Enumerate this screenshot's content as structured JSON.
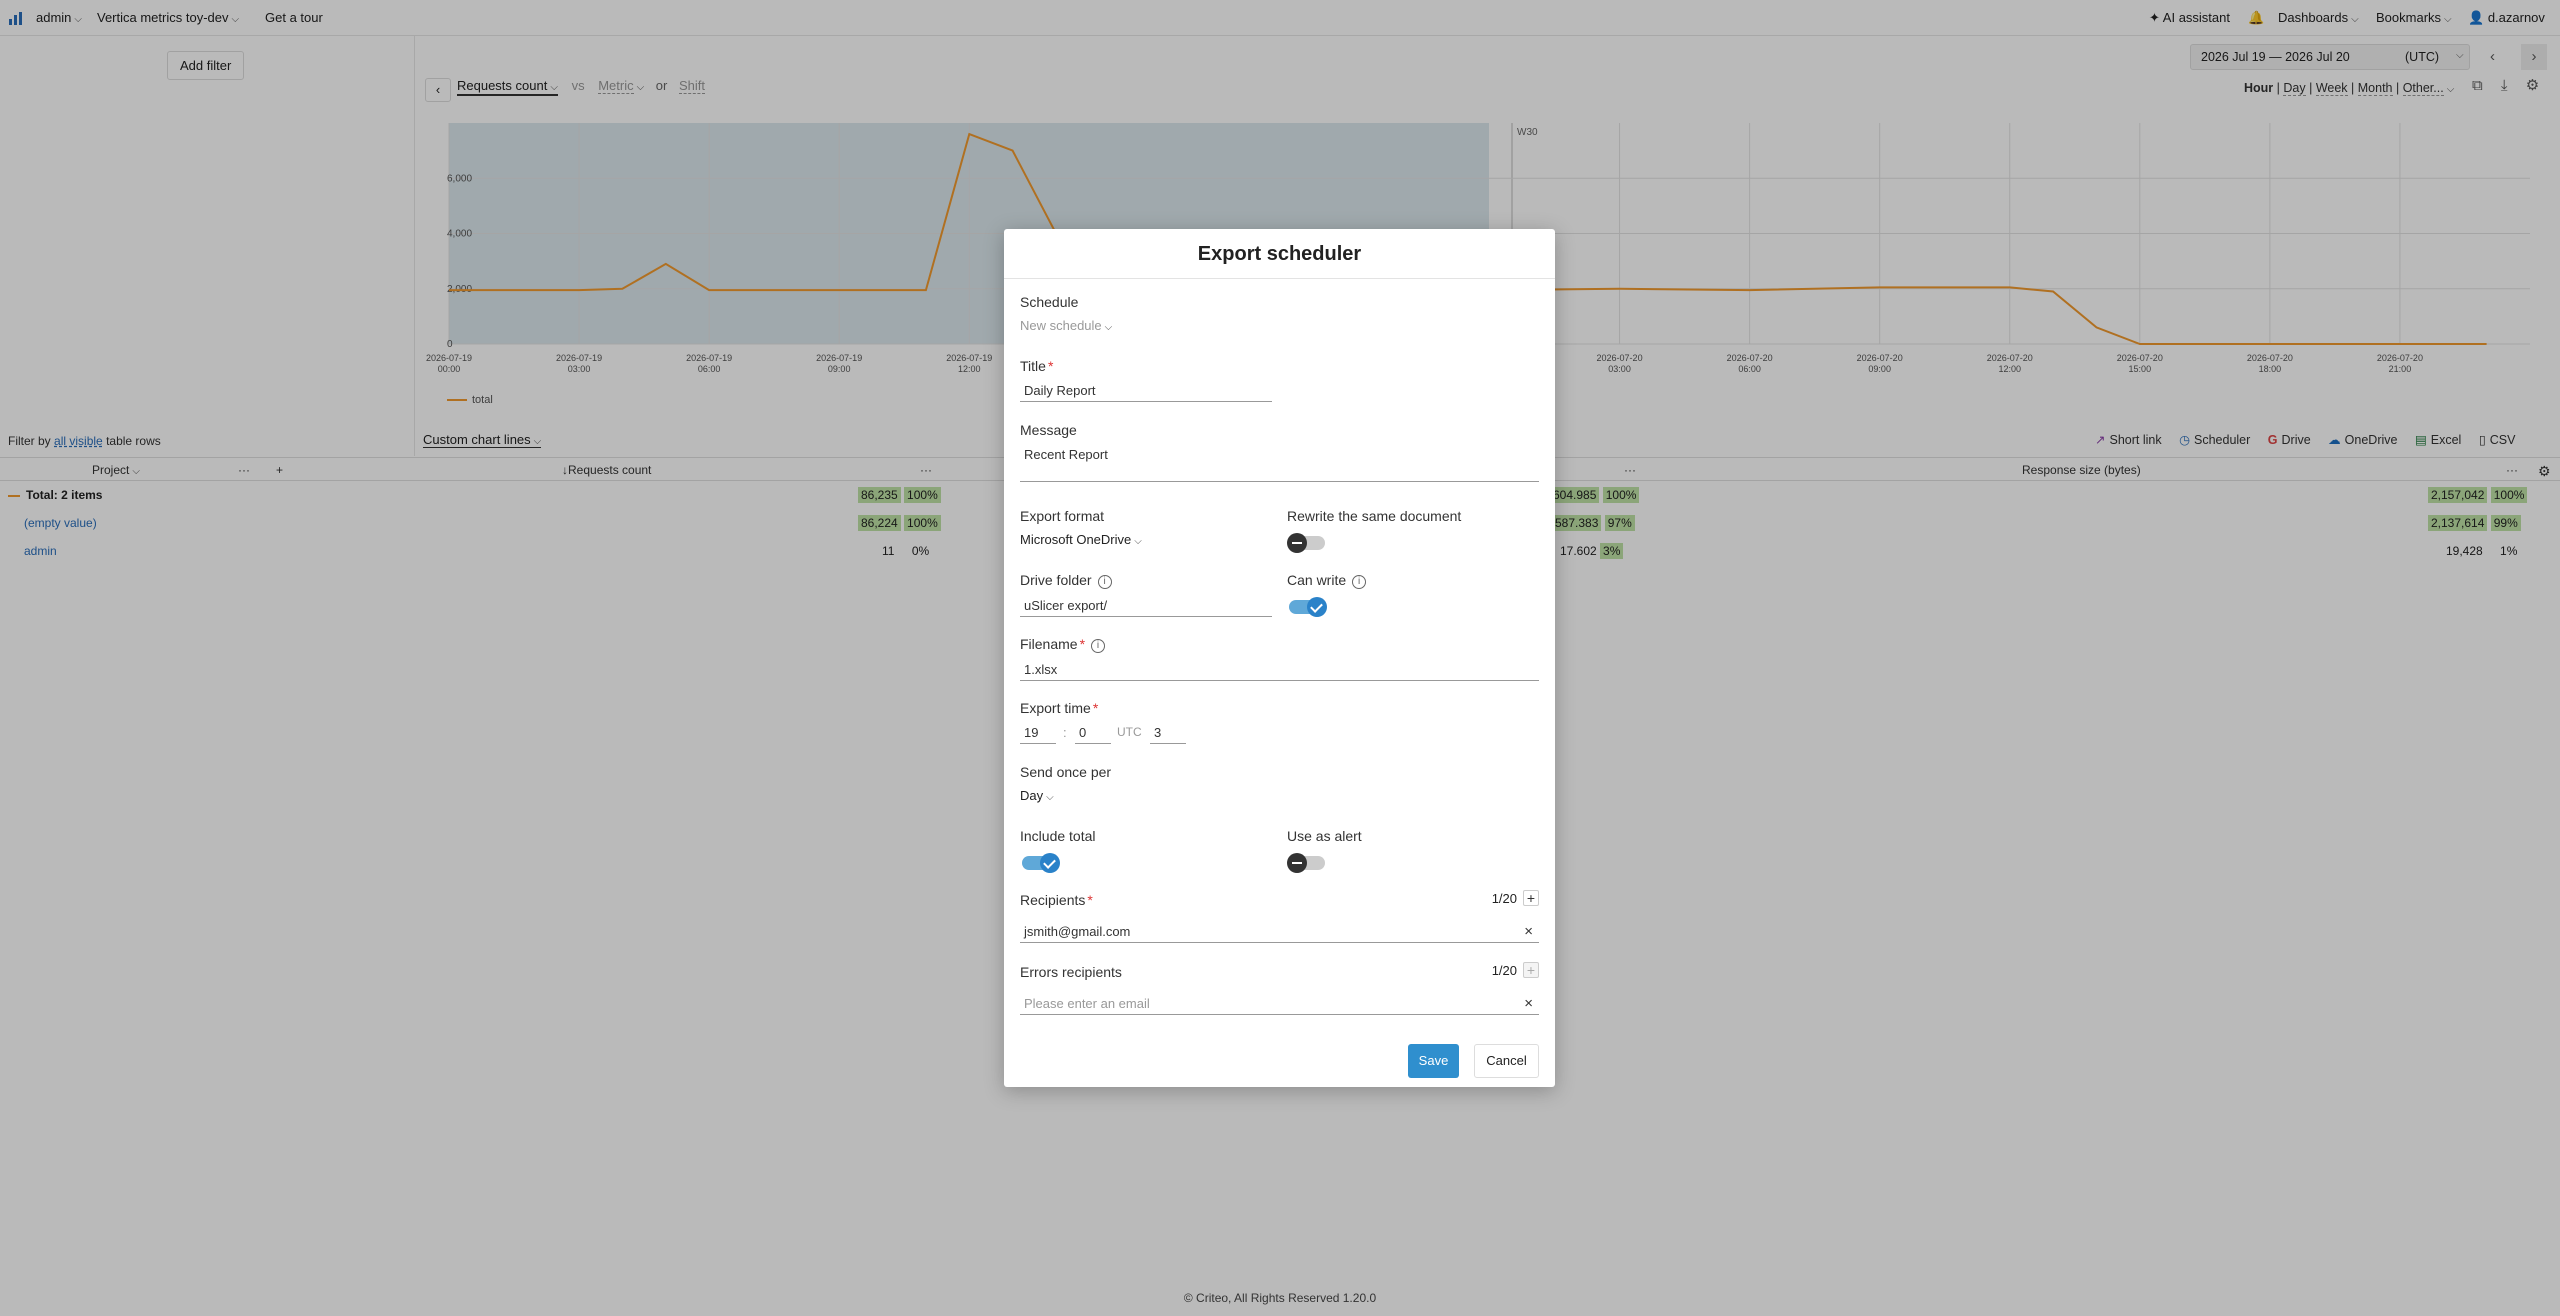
{
  "topbar": {
    "user_menu": "admin",
    "project": "Vertica metrics toy-dev",
    "tour": "Get a tour",
    "ai_assistant": "AI assistant",
    "dashboards": "Dashboards",
    "bookmarks": "Bookmarks",
    "account": "d.azarnov"
  },
  "left": {
    "add_filter": "Add filter",
    "filter_by_prefix": "Filter by",
    "filter_by_link": "all visible",
    "filter_by_suffix": "table rows"
  },
  "chart_controls": {
    "metric": "Requests count",
    "vs": "vs",
    "metric_placeholder": "Metric",
    "or": "or",
    "shift": "Shift",
    "date_range": "2026 Jul 19 — 2026 Jul 20",
    "timezone": "(UTC)",
    "granularity": [
      "Hour",
      "Day",
      "Week",
      "Month",
      "Other..."
    ],
    "granularity_selected": "Hour",
    "custom_chart_lines": "Custom chart lines"
  },
  "chart_data": {
    "type": "line",
    "series": [
      {
        "name": "total",
        "color": "#f29a2e",
        "points": [
          [
            "2026-07-19 00:00",
            1950
          ],
          [
            "2026-07-19 03:00",
            1950
          ],
          [
            "2026-07-19 04:00",
            2000
          ],
          [
            "2026-07-19 05:00",
            2900
          ],
          [
            "2026-07-19 06:00",
            1950
          ],
          [
            "2026-07-19 09:00",
            1950
          ],
          [
            "2026-07-19 11:00",
            1950
          ],
          [
            "2026-07-19 12:00",
            7600
          ],
          [
            "2026-07-19 13:00",
            7000
          ],
          [
            "2026-07-19 14:00",
            4000
          ],
          [
            "2026-07-20 00:00",
            1950
          ],
          [
            "2026-07-20 03:00",
            2000
          ],
          [
            "2026-07-20 06:00",
            1950
          ],
          [
            "2026-07-20 09:00",
            2050
          ],
          [
            "2026-07-20 12:00",
            2050
          ],
          [
            "2026-07-20 13:00",
            1900
          ],
          [
            "2026-07-20 14:00",
            600
          ],
          [
            "2026-07-20 15:00",
            0
          ],
          [
            "2026-07-20 23:00",
            0
          ]
        ]
      }
    ],
    "x_tick_labels": [
      [
        "2026-07-19",
        "00:00"
      ],
      [
        "2026-07-19",
        "03:00"
      ],
      [
        "2026-07-19",
        "06:00"
      ],
      [
        "2026-07-19",
        "09:00"
      ],
      [
        "2026-07-19",
        "12:00"
      ],
      [
        "2026-07-20",
        "03:00"
      ],
      [
        "2026-07-20",
        "06:00"
      ],
      [
        "2026-07-20",
        "09:00"
      ],
      [
        "2026-07-20",
        "12:00"
      ],
      [
        "2026-07-20",
        "15:00"
      ],
      [
        "2026-07-20",
        "18:00"
      ],
      [
        "2026-07-20",
        "21:00"
      ]
    ],
    "y_ticks": [
      "0",
      "2,000",
      "4,000",
      "6,000"
    ],
    "ylim": [
      0,
      8000
    ],
    "week_label": "W30",
    "legend": "total"
  },
  "export_bar": {
    "short_link": "Short link",
    "scheduler": "Scheduler",
    "drive": "Drive",
    "onedrive": "OneDrive",
    "excel": "Excel",
    "csv": "CSV"
  },
  "table": {
    "col_project": "Project",
    "col_requests": "Requests count",
    "col_response": "Response size (bytes)",
    "rows": [
      {
        "name": "Total: 2 items",
        "req": "86,235",
        "req_pct": "100%",
        "mid": "604.985",
        "mid_pct": "100%",
        "resp": "2,157,042",
        "resp_pct": "100%"
      },
      {
        "name": "(empty value)",
        "req": "86,224",
        "req_pct": "100%",
        "mid": "587.383",
        "mid_pct": "97%",
        "resp": "2,137,614",
        "resp_pct": "99%"
      },
      {
        "name": "admin",
        "req": "11",
        "req_pct": "0%",
        "mid": "17.602",
        "mid_pct": "3%",
        "resp": "19,428",
        "resp_pct": "1%"
      }
    ]
  },
  "footer": "© Criteo, All Rights Reserved 1.20.0",
  "modal": {
    "title": "Export scheduler",
    "schedule_label": "Schedule",
    "schedule_value": "New schedule",
    "title_label": "Title",
    "title_value": "Daily Report",
    "message_label": "Message",
    "message_value": "Recent Report",
    "export_format_label": "Export format",
    "export_format_value": "Microsoft OneDrive",
    "rewrite_label": "Rewrite the same document",
    "rewrite_on": false,
    "drive_folder_label": "Drive folder",
    "drive_folder_value": "uSlicer export/",
    "can_write_label": "Can write",
    "can_write_on": true,
    "filename_label": "Filename",
    "filename_value": "1.xlsx",
    "export_time_label": "Export time",
    "hour": "19",
    "minute": "0",
    "tz_label": "UTC",
    "tz_offset": "3",
    "send_once_label": "Send once per",
    "send_once_value": "Day",
    "include_total_label": "Include total",
    "include_total_on": true,
    "use_as_alert_label": "Use as alert",
    "use_as_alert_on": false,
    "recipients_label": "Recipients",
    "recipients_count": "1/20",
    "recipient_value": "jsmith@gmail.com",
    "errors_label": "Errors recipients",
    "errors_count": "1/20",
    "errors_placeholder": "Please enter an email",
    "save": "Save",
    "cancel": "Cancel"
  }
}
